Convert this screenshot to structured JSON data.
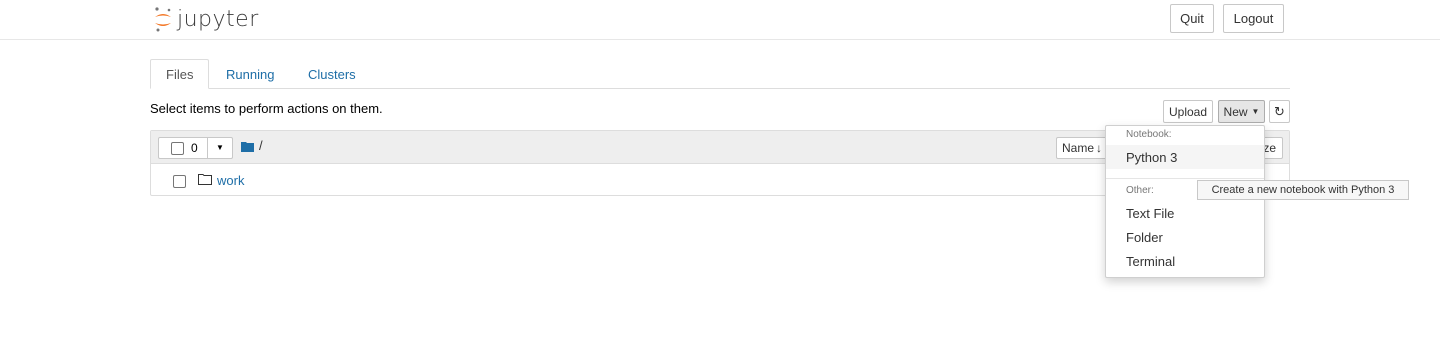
{
  "header": {
    "logo_text": "jupyter",
    "quit_label": "Quit",
    "logout_label": "Logout"
  },
  "tabs": [
    {
      "label": "Files",
      "active": true
    },
    {
      "label": "Running",
      "active": false
    },
    {
      "label": "Clusters",
      "active": false
    }
  ],
  "toolbar": {
    "instructions": "Select items to perform actions on them.",
    "upload_label": "Upload",
    "new_label": "New",
    "refresh_icon": "refresh-icon"
  },
  "file_list": {
    "selected_count": "0",
    "path": "/",
    "sort_label": "Name",
    "size_label": "ze",
    "items": [
      {
        "name": "work",
        "type": "folder"
      }
    ]
  },
  "new_menu": {
    "notebook_header": "Notebook:",
    "notebook_items": [
      "Python 3"
    ],
    "other_header": "Other:",
    "other_items": [
      "Text File",
      "Folder",
      "Terminal"
    ]
  },
  "tooltip": "Create a new notebook with Python 3",
  "colors": {
    "link": "#1e6ea7",
    "jupyter_orange": "#f37726"
  }
}
